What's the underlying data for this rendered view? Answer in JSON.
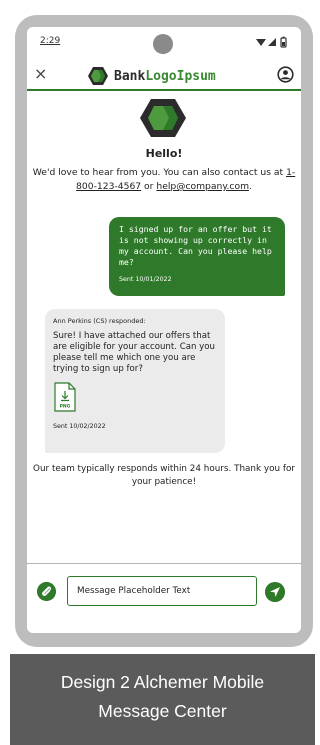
{
  "status_bar": {
    "time": "2:29"
  },
  "header": {
    "close_label": "×",
    "brand": {
      "part_bank": "Bank",
      "part_logo": "Logo",
      "part_ipsum": "Ipsum"
    }
  },
  "intro": {
    "greeting": "Hello!",
    "text_before_phone": "We'd love to hear from you. You can also contact us at ",
    "phone": "1-800-123-4567",
    "text_between": " or ",
    "email": "help@company.com",
    "text_after": "."
  },
  "messages": [
    {
      "direction": "outgoing",
      "text": "I signed up for an offer but it is not showing up correctly in my account. Can you please help me?",
      "sent": "Sent 10/01/2022"
    },
    {
      "direction": "incoming",
      "author": "Ann Perkins (CS) responded:",
      "text": "Sure! I have attached our offers that are eligible for your account. Can you please tell me which one you are trying to sign up for?",
      "attachment_type": "PNG",
      "sent": "Sent 10/02/2022"
    }
  ],
  "team_note": "Our team typically responds within 24 hours. Thank you for your patience!",
  "composer": {
    "placeholder": "Message Placeholder Text"
  },
  "caption": {
    "line1": "Design 2 Alchemer Mobile",
    "line2": "Message Center"
  },
  "colors": {
    "brand_green": "#2f7a2a",
    "incoming_bubble": "#ebebeb",
    "device_frame": "#bdbdbd",
    "caption_bg": "#5b5b5b"
  },
  "icons": [
    "close-icon",
    "bank-logo-icon",
    "profile-icon",
    "wifi-icon",
    "signal-icon",
    "battery-icon",
    "png-file-icon",
    "paperclip-icon",
    "send-icon"
  ]
}
